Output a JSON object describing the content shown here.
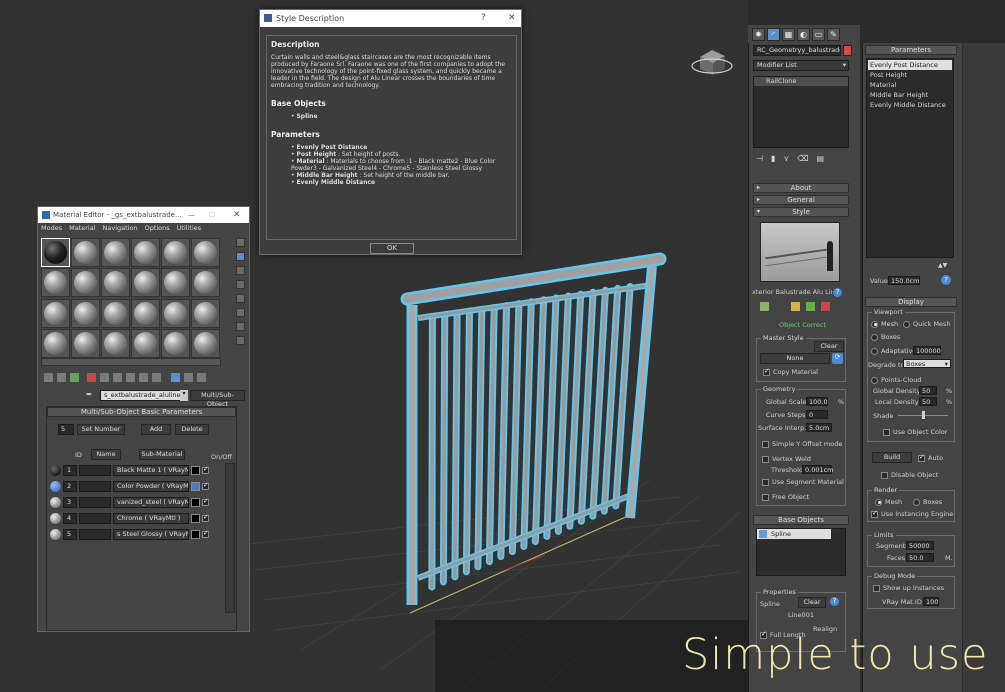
{
  "overlay_text": "Simple to use",
  "style_dialog": {
    "title": "Style Description",
    "help_btn": "?",
    "close_btn": "✕",
    "desc_heading": "Description",
    "desc_text": "Curtain walls and steel&glass staircases are the most recognizable items produced by Faraone Srl. Faraone was one of the first companies to adopt the innovative technology of the point-fixed glass system, and quickly became a leader in the field. The design of Alu Linear crosses the boundaries of time embracing tradition and technology.",
    "base_heading": "Base Objects",
    "base_items": [
      "Spline"
    ],
    "params_heading": "Parameters",
    "param_lines": [
      {
        "bold": "Evenly Post Distance",
        "rest": ""
      },
      {
        "bold": "Post Height",
        "rest": " : Set height of posts."
      },
      {
        "bold": "Material",
        "rest": " : Materials to choose from :1 - Black matte2 - Blue Color Powder3 - Galvanized Steel4 - Chrome5 - Stainless Steel Glossy"
      },
      {
        "bold": "Middle Bar Height",
        "rest": " : Set height of the middle bar."
      },
      {
        "bold": "Evenly Middle Distance",
        "rest": ""
      }
    ],
    "ok_label": "OK"
  },
  "material_editor": {
    "title": "Material Editor - _gs_extbalustrade...",
    "menu": [
      "Modes",
      "Material",
      "Navigation",
      "Options",
      "Utilities"
    ],
    "mat_name": "s_extbalustrade_alulinear",
    "mat_type": "Multi/Sub-Object",
    "rollout": "Multi/Sub-Object Basic Parameters",
    "count": "5",
    "set_number": "Set Number",
    "add": "Add",
    "delete": "Delete",
    "col_id": "ID",
    "col_name": "Name",
    "col_sub": "Sub-Material",
    "col_onoff": "On/Off",
    "rows": [
      {
        "id": "1",
        "sub": "Black Matte 1  ( VRayMtl )",
        "swatch": "#000000"
      },
      {
        "id": "2",
        "sub": "Color Powder  ( VRayMtl )",
        "swatch": "#4a78c8"
      },
      {
        "id": "3",
        "sub": "vanized_steel  ( VRayMtl )",
        "swatch": "#000000"
      },
      {
        "id": "4",
        "sub": "Chrome  ( VRayMtl )",
        "swatch": "#000000"
      },
      {
        "id": "5",
        "sub": "s Steel Glossy  ( VRayMtl )",
        "swatch": "#000000"
      }
    ]
  },
  "command_panel": {
    "object_name": "RC_Geometryy_balustrades",
    "modifier_list": "Modifier List",
    "stack_item": "RailClone",
    "rollouts": {
      "about": "About",
      "general": "General",
      "style": "Style"
    },
    "style_name": "xterior Balustrade Alu Line",
    "object_status": "Object Correct",
    "master_style": "Master Style",
    "clear": "Clear",
    "none": "None",
    "copy_material": "Copy Material",
    "geometry": "Geometry",
    "global_scale_label": "Global Scale",
    "global_scale": "100.0",
    "pct": "%",
    "curve_steps_label": "Curve Steps",
    "curve_steps": "0",
    "surface_interp_label": "Surface Interp.",
    "surface_interp": "5.0cm",
    "simple_y": "Simple Y Offset mode",
    "vertex_weld": "Vertex Weld",
    "threshold_label": "Threshold",
    "threshold": "0.001cm",
    "use_segment": "Use Segment Material",
    "free_object": "Free Object",
    "base_objects": "Base Objects",
    "base_item": "Spline",
    "properties": "Properties",
    "spline_label": "Spline",
    "line_name": "Line001",
    "realign": "Realign",
    "full_length": "Full Length"
  },
  "params_panel": {
    "title": "Parameters",
    "list": [
      "Evenly Post Distance",
      "Post Height",
      "Material",
      "Middle Bar Height",
      "Evenly Middle Distance"
    ],
    "value_label": "Value",
    "value": "150.0cm",
    "display_title": "Display",
    "viewport": "Viewport",
    "mesh": "Mesh",
    "quick_mesh": "Quick Mesh",
    "boxes": "Boxes",
    "adaptative": "Adaptative",
    "adaptative_val": "100000",
    "degrade_label": "Degrade to",
    "degrade_val": "Boxes",
    "points_cloud": "Points-Cloud",
    "global_density_label": "Global Density",
    "global_density": "50",
    "local_density_label": "Local Density",
    "local_density": "50",
    "shade": "Shade",
    "use_object_color": "Use Object Color",
    "build": "Build",
    "auto": "Auto",
    "disable_object": "Disable Object",
    "render": "Render",
    "render_mesh": "Mesh",
    "render_boxes": "Boxes",
    "use_instancing": "Use Instancing Engine",
    "limits": "Limits",
    "segments_label": "Segments",
    "segments": "50000",
    "faces_label": "Faces",
    "faces": "50.0",
    "faces_unit": "M.",
    "debug_mode": "Debug Mode",
    "show_instances": "Show up Instances",
    "vray_mat_label": "VRay Mat.ID",
    "vray_mat": "100"
  },
  "colors": {
    "accent": "#5b8fcf",
    "selection": "#5ec8f0",
    "status_green": "#5ed65e",
    "overlay_text": "#f0e6a8"
  }
}
